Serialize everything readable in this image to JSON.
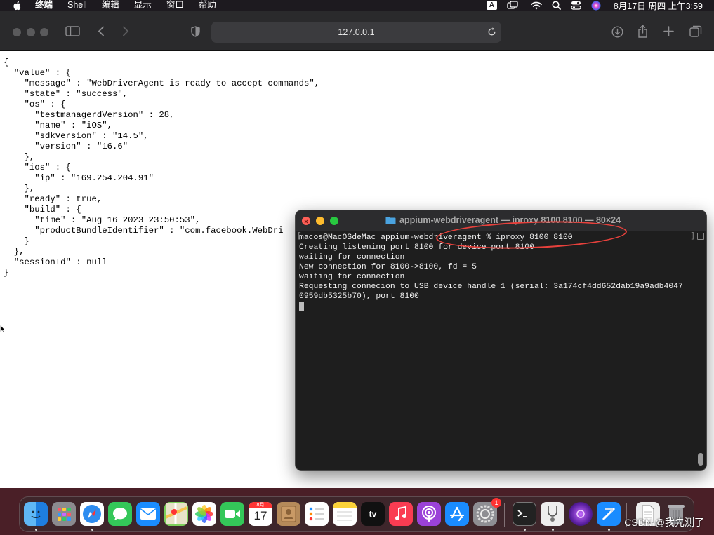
{
  "menubar": {
    "app_name": "终端",
    "menus": [
      "Shell",
      "编辑",
      "显示",
      "窗口",
      "帮助"
    ],
    "input_method": "A",
    "clock": "8月17日 周四 上午3:59"
  },
  "browser": {
    "url": "127.0.0.1"
  },
  "page_json": "{\n  \"value\" : {\n    \"message\" : \"WebDriverAgent is ready to accept commands\",\n    \"state\" : \"success\",\n    \"os\" : {\n      \"testmanagerdVersion\" : 28,\n      \"name\" : \"iOS\",\n      \"sdkVersion\" : \"14.5\",\n      \"version\" : \"16.6\"\n    },\n    \"ios\" : {\n      \"ip\" : \"169.254.204.91\"\n    },\n    \"ready\" : true,\n    \"build\" : {\n      \"time\" : \"Aug 16 2023 23:50:53\",\n      \"productBundleIdentifier\" : \"com.facebook.WebDri\n    }\n  },\n  \"sessionId\" : null\n}",
  "terminal": {
    "title": "appium-webdriveragent — iproxy 8100 8100 — 80×24",
    "lines": [
      "macos@MacOSdeMac appium-webdriveragent % iproxy 8100 8100",
      "Creating listening port 8100 for device port 8100",
      "waiting for connection",
      "New connection for 8100->8100, fd = 5",
      "waiting for connection",
      "Requesting connecion to USB device handle 1 (serial: 3a174cf4dd652dab19a9adb4047",
      "0959db5325b70), port 8100"
    ]
  },
  "dock": {
    "calendar_month": "8月",
    "calendar_day": "17",
    "appstore_badge": "1",
    "tv_label": "tv"
  },
  "watermark": "CSDN @我先测了"
}
